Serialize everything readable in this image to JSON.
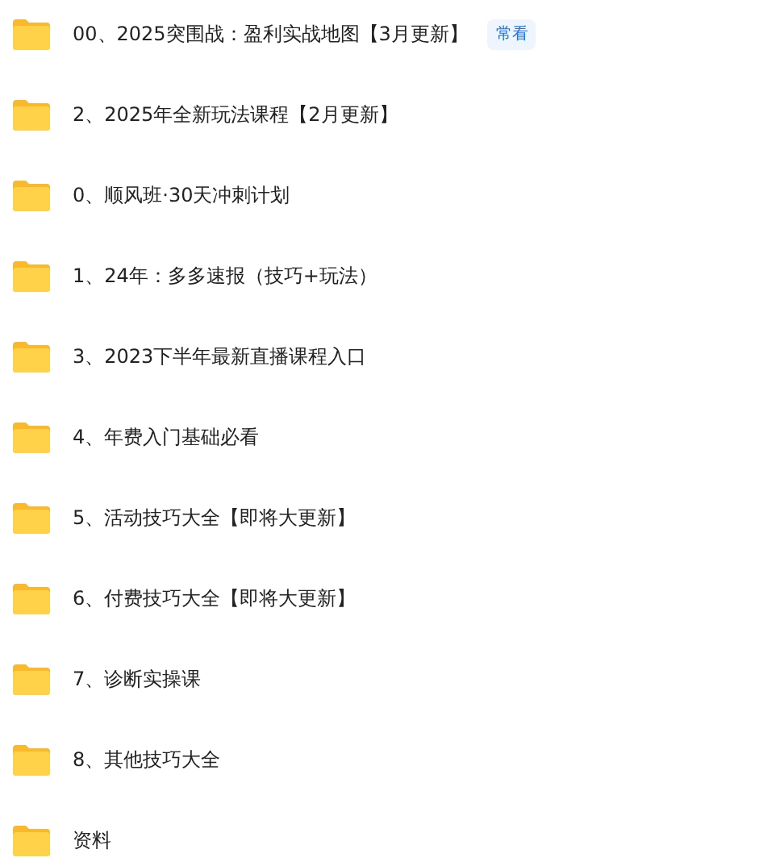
{
  "folders": [
    {
      "name": "00、2025突围战：盈利实战地图【3月更新】",
      "badge": "常看"
    },
    {
      "name": "2、2025年全新玩法课程【2月更新】"
    },
    {
      "name": "0、顺风班·30天冲刺计划"
    },
    {
      "name": "1、24年：多多速报（技巧+玩法）"
    },
    {
      "name": "3、2023下半年最新直播课程入口"
    },
    {
      "name": "4、年费入门基础必看"
    },
    {
      "name": "5、活动技巧大全【即将大更新】"
    },
    {
      "name": "6、付费技巧大全【即将大更新】"
    },
    {
      "name": "7、诊断实操课"
    },
    {
      "name": "8、其他技巧大全"
    },
    {
      "name": "资料"
    }
  ]
}
